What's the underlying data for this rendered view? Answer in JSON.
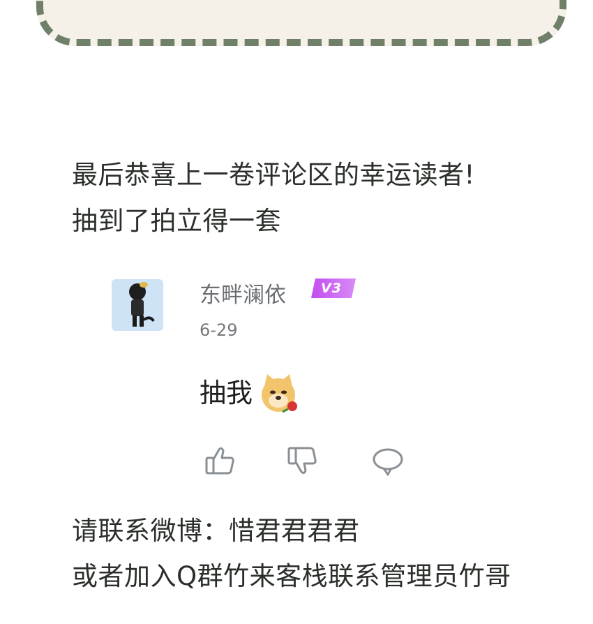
{
  "announcement": {
    "line1": "最后恭喜上一卷评论区的幸运读者!",
    "line2": "抽到了拍立得一套",
    "line3": "请联系微博：惜君君君君",
    "line4": "或者加入Q群竹来客栈联系管理员竹哥"
  },
  "comment": {
    "username": "东畔澜依",
    "level": "V3",
    "date": "6-29",
    "text": "抽我",
    "emoji": "doge-rose-emoji",
    "actions": [
      "thumbs-up-icon",
      "thumbs-down-icon",
      "comment-bubble-icon"
    ]
  },
  "colors": {
    "frame_fill": "#f5f1e8",
    "frame_dash": "#6f7f68",
    "text": "#2a2f2a",
    "badge": "#b95be8",
    "meta": "#75797d"
  }
}
